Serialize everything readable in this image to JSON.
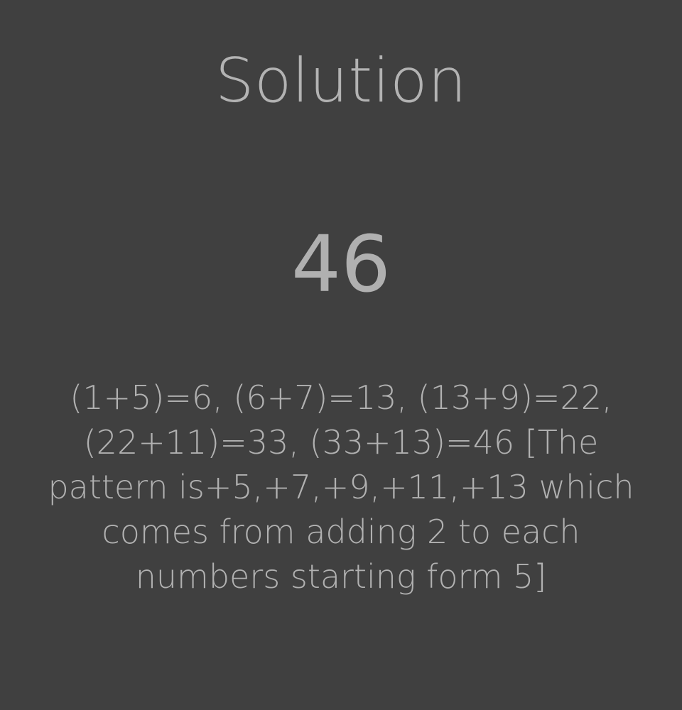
{
  "solution": {
    "title": "Solution",
    "answer": "46",
    "explanation": "(1+5)=6, (6+7)=13, (13+9)=22, (22+11)=33, (33+13)=46 [The pattern is+5,+7,+9,+11,+13 which comes from adding 2 to each numbers starting form 5]"
  },
  "colors": {
    "background": "#404040",
    "text": "#b0b0b0"
  }
}
